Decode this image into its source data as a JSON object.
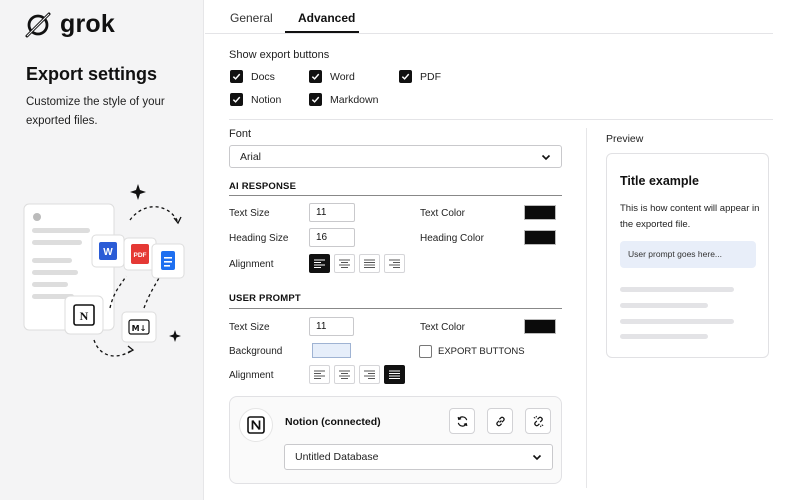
{
  "brand": {
    "name": "grok",
    "logo_icon": "grok-logo-icon"
  },
  "sidebar": {
    "title": "Export settings",
    "description": "Customize the style of your exported files.",
    "illustration_labels": {
      "pdf": "PDF",
      "word": "W",
      "markdown": "M↓",
      "notion": "N"
    }
  },
  "tabs": [
    {
      "label": "General",
      "active": false
    },
    {
      "label": "Advanced",
      "active": true
    }
  ],
  "export_buttons": {
    "label": "Show export buttons",
    "items": [
      {
        "label": "Docs",
        "checked": true
      },
      {
        "label": "Word",
        "checked": true
      },
      {
        "label": "PDF",
        "checked": true
      },
      {
        "label": "Notion",
        "checked": true
      },
      {
        "label": "Markdown",
        "checked": true
      }
    ]
  },
  "font": {
    "label": "Font",
    "value": "Arial"
  },
  "ai_response": {
    "heading": "AI RESPONSE",
    "text_size_label": "Text Size",
    "text_size": "11",
    "heading_size_label": "Heading Size",
    "heading_size": "16",
    "text_color_label": "Text Color",
    "text_color": "#0b0b0b",
    "heading_color_label": "Heading Color",
    "heading_color": "#0b0b0b",
    "alignment_label": "Alignment",
    "alignment": "left"
  },
  "user_prompt": {
    "heading": "USER PROMPT",
    "text_size_label": "Text Size",
    "text_size": "11",
    "text_color_label": "Text Color",
    "text_color": "#0b0b0b",
    "background_label": "Background",
    "background_color": "#e6eefa",
    "export_buttons_label": "EXPORT BUTTONS",
    "export_buttons_checked": false,
    "alignment_label": "Alignment",
    "alignment": "justify"
  },
  "notion": {
    "title": "Notion (connected)",
    "database": "Untitled Database",
    "actions": [
      "refresh-icon",
      "link-icon",
      "unlink-icon"
    ]
  },
  "preview": {
    "label": "Preview",
    "title": "Title example",
    "body": "This is how content will appear in the exported file.",
    "prompt": "User prompt goes here..."
  },
  "colors": {
    "accent": "#111111",
    "panel_bg": "#f4f4f5",
    "prompt_bg": "#e8eef9"
  }
}
